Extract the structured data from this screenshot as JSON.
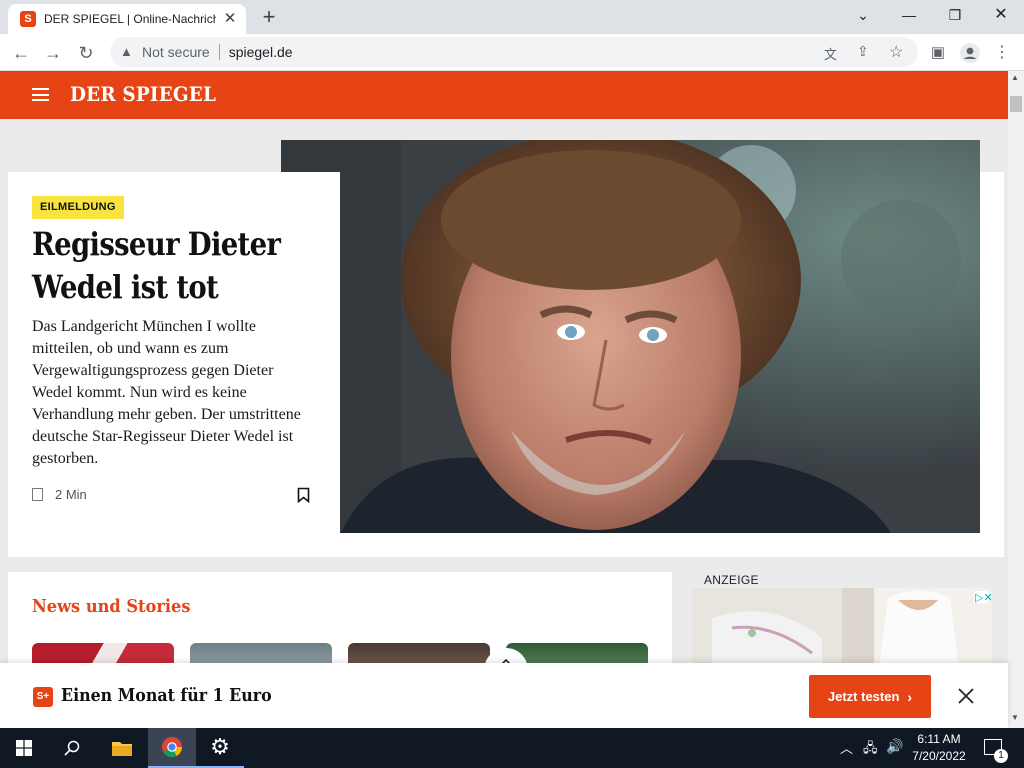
{
  "browser": {
    "tab_title": "DER SPIEGEL | Online-Nachrichten",
    "tab_favicon": "S",
    "security_label": "Not secure",
    "url": "spiegel.de"
  },
  "site": {
    "logo": "DER SPIEGEL",
    "brand_color": "#e64415"
  },
  "hero": {
    "badge": "EILMELDUNG",
    "headline": "Regisseur Dieter Wedel ist tot",
    "teaser": "Das Landgericht München I wollte mitteilen, ob und wann es zum Vergewaltigungsprozess gegen Dieter Wedel kommt. Nun wird es keine Verhandlung mehr geben. Der umstrittene deutsche Star-Regisseur Dieter Wedel ist gestorben.",
    "read_time": "2 Min"
  },
  "news": {
    "title": "News und Stories"
  },
  "ad": {
    "label": "ANZEIGE"
  },
  "promo": {
    "icon": "S+",
    "text": "Einen Monat für 1 Euro",
    "button": "Jetzt testen",
    "button_chevron": "›"
  },
  "taskbar": {
    "time": "6:11 AM",
    "date": "7/20/2022",
    "notifications": "1"
  }
}
